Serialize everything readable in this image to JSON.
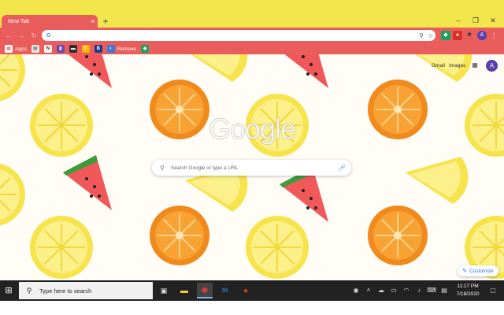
{
  "browser": {
    "tab_title": "New Tab",
    "tab_close": "×",
    "new_tab": "+",
    "window_controls": {
      "minimize": "–",
      "maximize": "❐",
      "close": "✕"
    },
    "omnibox_text": "",
    "profile_initial": "A",
    "menu": "⋮"
  },
  "bookmarks": [
    {
      "icon": "apps-grid-icon",
      "label": "Apps",
      "color": "#ea5d5d"
    },
    {
      "icon": "bookmark-icon",
      "label": "",
      "color": "#e8e8e8"
    },
    {
      "icon": "netflix-icon",
      "label": "",
      "color": "#b00710"
    },
    {
      "icon": "bookmark-icon",
      "label": "",
      "color": "#6b4bb3"
    },
    {
      "icon": "bookmark-icon",
      "label": "",
      "color": "#2d2d2d"
    },
    {
      "icon": "bookmark-icon",
      "label": "",
      "color": "#f4b400"
    },
    {
      "icon": "bookmark-icon",
      "label": "",
      "color": "#1e3a8a"
    },
    {
      "icon": "bookmark-icon",
      "label": "Remove",
      "color": "#3c7bd6"
    },
    {
      "icon": "bookmark-icon",
      "label": "",
      "color": "#1aa260"
    }
  ],
  "ntp": {
    "logo": "Google",
    "search_placeholder": "Search Google or type a URL",
    "gmail": "Gmail",
    "images": "Images",
    "avatar": "A",
    "customize": "Customize"
  },
  "taskbar": {
    "search_text": "Type here to search",
    "time": "11:17 PM",
    "date": "7/18/2020"
  },
  "colors": {
    "tab_strip": "#f2e64c",
    "toolbar": "#ea5d5d",
    "taskbar": "#222222"
  }
}
